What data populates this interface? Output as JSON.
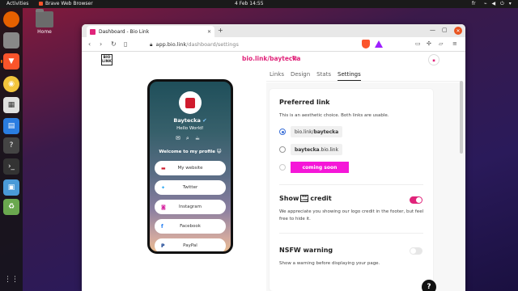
{
  "topbar": {
    "activities": "Activities",
    "app_name": "Brave Web Browser",
    "clock": "4 Feb  14:55",
    "lang": "fr",
    "tray": "⌁ ◀ ⏻ ▾"
  },
  "desktop": {
    "home_label": "Home"
  },
  "browser": {
    "tab_title": "Dashboard - Bio Link",
    "url_host": "app.bio.link",
    "url_path": "/dashboard/settings"
  },
  "page": {
    "logo": "BIO LINK",
    "site_link": "bio.link/baytecka",
    "tabs": [
      "Links",
      "Design",
      "Stats",
      "Settings"
    ],
    "active_tab": "Settings"
  },
  "profile": {
    "name": "Baytecka",
    "verified": "✔",
    "bio": "Hello World!",
    "welcome": "Welcome to my profile 😺",
    "links": [
      {
        "label": "My website",
        "icon": "website-icon"
      },
      {
        "label": "Twitter",
        "icon": "twitter-icon"
      },
      {
        "label": "Instagram",
        "icon": "instagram-icon"
      },
      {
        "label": "Facebook",
        "icon": "facebook-icon"
      },
      {
        "label": "PayPal",
        "icon": "paypal-icon"
      }
    ]
  },
  "settings": {
    "preferred": {
      "title": "Preferred link",
      "desc": "This is an aesthetic choice. Both links are usable.",
      "opt1_prefix": "bio.link/",
      "opt1_bold": "baytecka",
      "opt2_bold": "baytecka",
      "opt2_suffix": ".bio.link",
      "opt3": "coming soon",
      "selected": 1
    },
    "credit": {
      "title_pre": "Show",
      "title_post": "credit",
      "desc": "We appreciate you showing our logo credit in the footer, but feel free to hide it.",
      "enabled": true
    },
    "nsfw": {
      "title": "NSFW warning",
      "desc": "Show a warning before displaying your page.",
      "enabled": false
    }
  },
  "help": "?",
  "colors": {
    "accent": "#e0247a",
    "soon": "#f516d8",
    "brave": "#fb542b"
  }
}
